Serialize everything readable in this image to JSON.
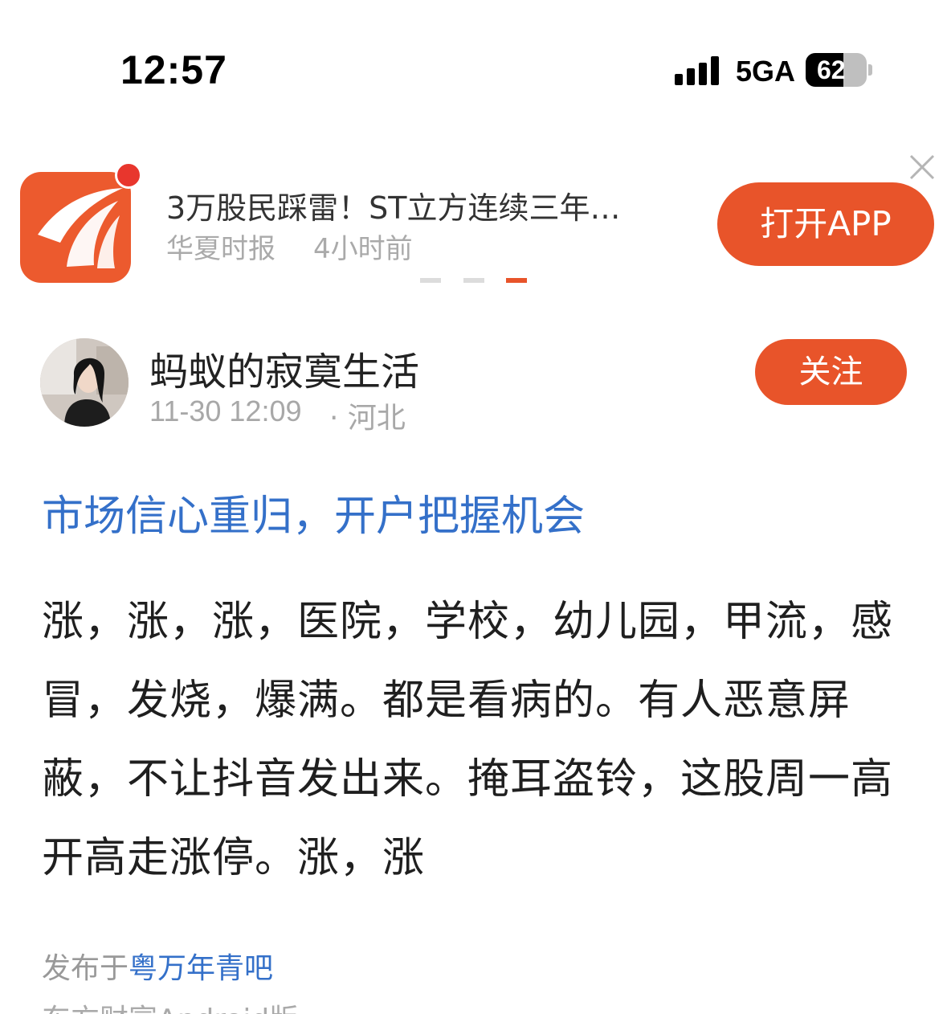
{
  "status_bar": {
    "time": "12:57",
    "network": "5GA",
    "battery": "62",
    "battery_level": 0.62
  },
  "banner": {
    "title": "3万股民踩雷！ST立方连续三年…",
    "source": "华夏时报",
    "time": "4小时前",
    "open_app_label": "打开APP",
    "accent_color": "#e8542a",
    "active_dot": 2,
    "dot_count": 3
  },
  "author": {
    "name": "蚂蚁的寂寞生活",
    "time": "11-30 12:09",
    "location": "· 河北",
    "follow_label": "关注"
  },
  "article": {
    "title": "市场信心重归，开户把握机会",
    "body": "涨，涨，涨，医院，学校，幼儿园，甲流，感冒，发烧，爆满。都是看病的。有人恶意屏蔽，不让抖音发出来。掩耳盗铃，这股周一高开高走涨停。涨，涨",
    "published_prefix": "发布于",
    "published_forum": "粤万年青吧",
    "client": "东方财富Android版",
    "title_color": "#3470c9"
  }
}
